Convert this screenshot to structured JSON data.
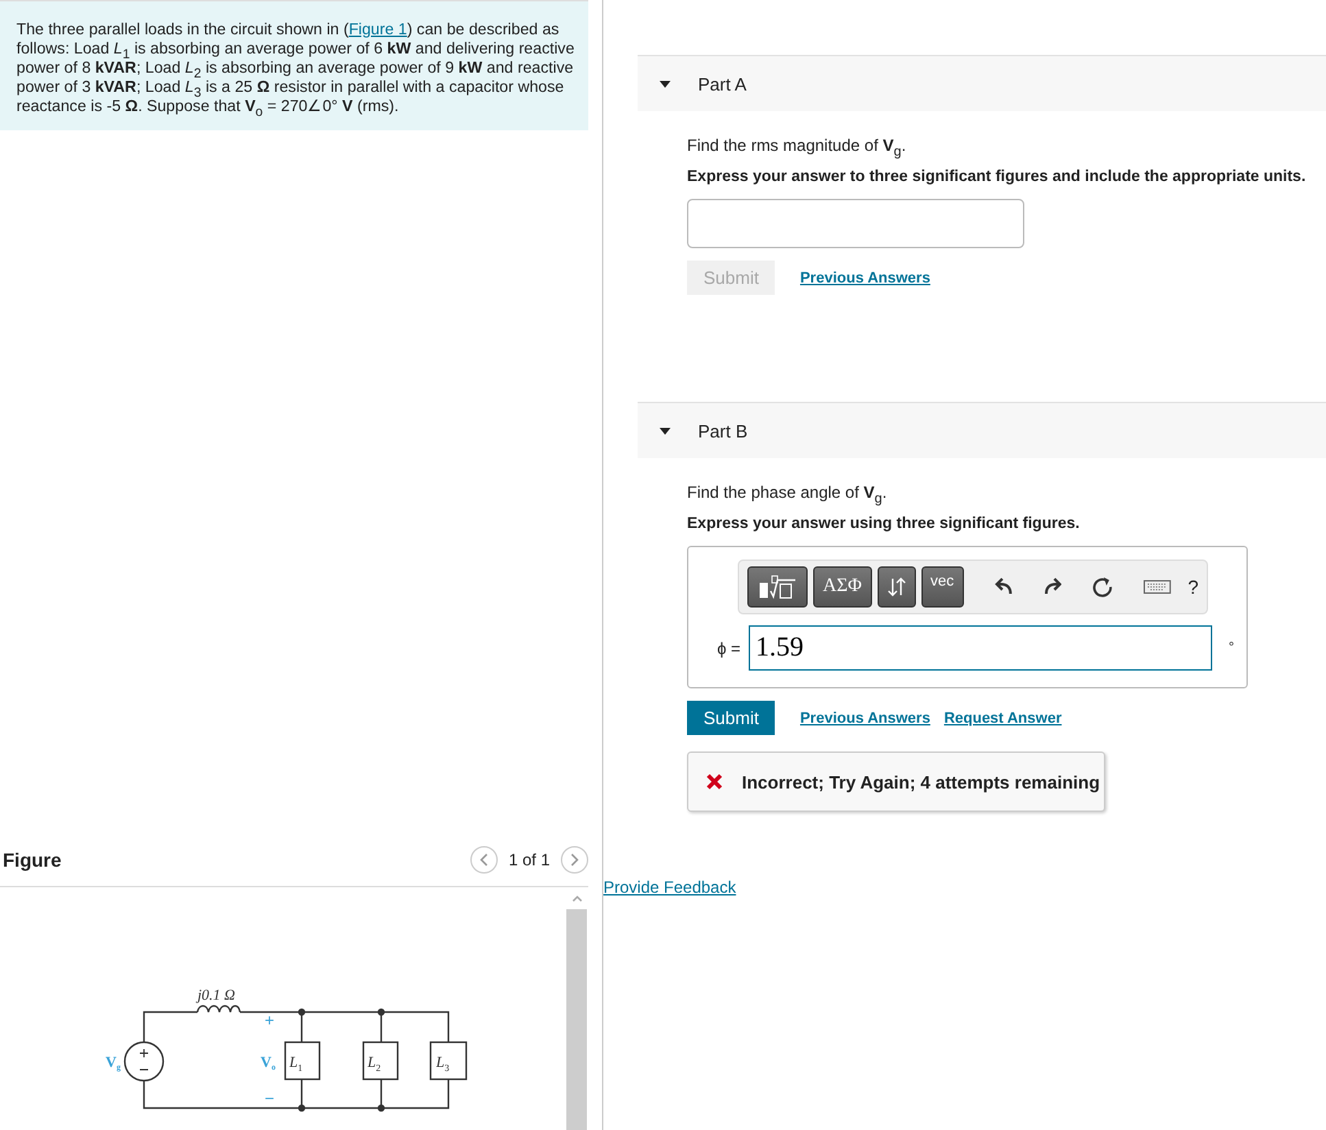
{
  "problem": {
    "before": "The three parallel loads in the circuit shown in (",
    "link": "Figure 1",
    "after": ") can be described as follows: Load *L*$_{1}$ is absorbing an average power of 6 **kW** and delivering reactive power of 8 **kVAR**; Load *L*$_{2}$ is absorbing an average power of 9 **kW** and reactive power of 3 **kVAR**; Load *L*$_{3}$ is a 25 **Ω** resistor in parallel with a capacitor whose reactance is -5 **Ω**. Suppose that **V**$_{o}$ = 270∠0° **V** (rms)."
  },
  "figure": {
    "title": "Figure",
    "pager": "1 of 1",
    "labels": {
      "inductor": "j0.1 Ω",
      "source": "V",
      "source_sub": "g",
      "plus": "+",
      "minus": "−",
      "output": "V",
      "output_sub": "o",
      "loads": [
        "*L*$_{1}$",
        "*L*$_{2}$",
        "*L*$_{3}$"
      ]
    }
  },
  "parts": [
    {
      "kind": "units",
      "label": "Part A",
      "expanded": true,
      "question": "Find the rms magnitude of **V**$_{g}$.",
      "instruction": "Express your answer to three significant figures and include the appropriate units.",
      "submit": {
        "label": "Submit",
        "disabled": true
      },
      "links": [
        "Previous Answers"
      ]
    },
    {
      "kind": "math",
      "label": "Part B",
      "expanded": true,
      "question": "Find the phase angle of **V**$_{g}$.",
      "instruction": "Express your answer using three significant figures.",
      "toolbar": {
        "buttons": [
          "ΑΣΦ",
          "vec"
        ],
        "help": "?"
      },
      "variable": "ϕ =",
      "value": "1.59",
      "unit": "°",
      "submit": {
        "label": "Submit",
        "disabled": false
      },
      "links": [
        "Previous Answers",
        "Request Answer"
      ],
      "feedback": {
        "kind": "incorrect",
        "text": "Incorrect; Try Again; 4 attempts remaining"
      }
    }
  ],
  "footer_link": "Provide Feedback"
}
